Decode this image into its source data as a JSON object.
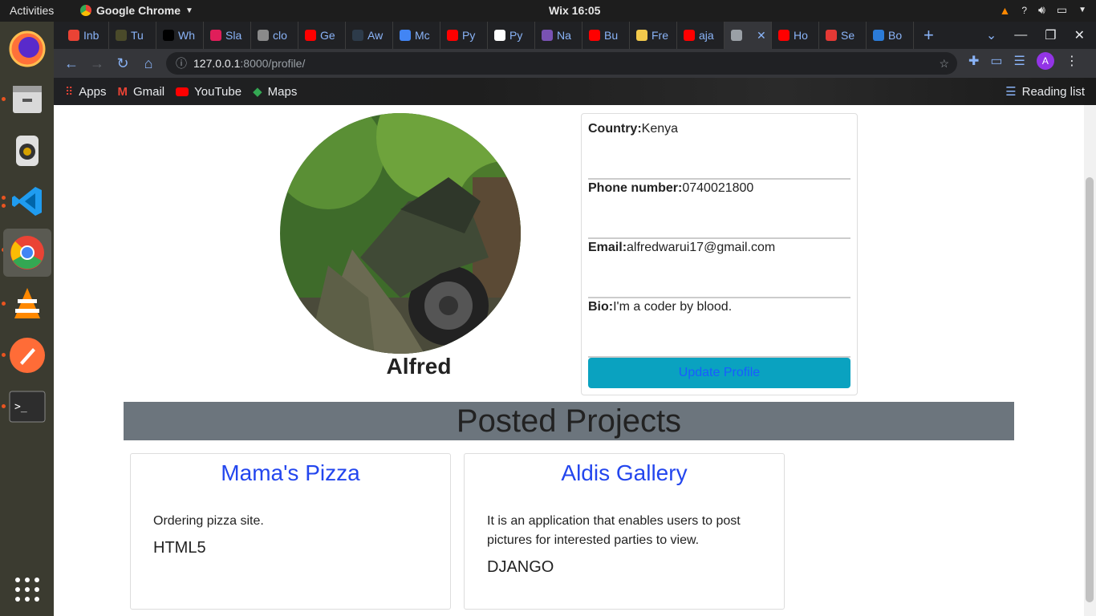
{
  "system_bar": {
    "activities": "Activities",
    "app_name": "Google Chrome",
    "clock": "Wix 16:05"
  },
  "browser": {
    "tabs": [
      {
        "label": "Inb",
        "color": "#ea4335"
      },
      {
        "label": "Tu",
        "color": "#4a4a2a"
      },
      {
        "label": "Wh",
        "color": "#000000"
      },
      {
        "label": "Sla",
        "color": "#e01e5a"
      },
      {
        "label": "clo",
        "color": "#8a8a8a"
      },
      {
        "label": "Ge",
        "color": "#ff0000"
      },
      {
        "label": "Aw",
        "color": "#2d3b4a"
      },
      {
        "label": "Mc",
        "color": "#4285f4"
      },
      {
        "label": "Py",
        "color": "#ff0000"
      },
      {
        "label": "Py",
        "color": "#ffffff"
      },
      {
        "label": "Na",
        "color": "#7952b3"
      },
      {
        "label": "Bu",
        "color": "#ff0000"
      },
      {
        "label": "Fre",
        "color": "#f2c94c"
      },
      {
        "label": "aja",
        "color": "#ff0000"
      },
      {
        "label": "",
        "color": "#9aa0a6"
      },
      {
        "label": "Ho",
        "color": "#ff0000"
      },
      {
        "label": "Se",
        "color": "#e53935"
      },
      {
        "label": "Bo",
        "color": "#2b7bd8"
      }
    ],
    "url_host": "127.0.0.1",
    "url_rest": ":8000/profile/",
    "bookmarks": [
      "Apps",
      "Gmail",
      "YouTube",
      "Maps"
    ],
    "reading_list": "Reading list",
    "profile_initial": "A"
  },
  "profile": {
    "username": "Alfred",
    "fields": [
      {
        "label": "Country:",
        "value": "Kenya"
      },
      {
        "label": "Phone number:",
        "value": "0740021800"
      },
      {
        "label": "Email:",
        "value": "alfredwarui17@gmail.com"
      },
      {
        "label": "Bio:",
        "value": "I'm a coder by blood."
      }
    ],
    "update_button": "Update Profile"
  },
  "projects": {
    "heading": "Posted Projects",
    "items": [
      {
        "title": "Mama's Pizza",
        "description": "Ordering pizza site.",
        "tech": "HTML5"
      },
      {
        "title": "Aldis Gallery",
        "description": "It is an application that enables users to post pictures for interested parties to view.",
        "tech": "DJANGO"
      }
    ]
  }
}
